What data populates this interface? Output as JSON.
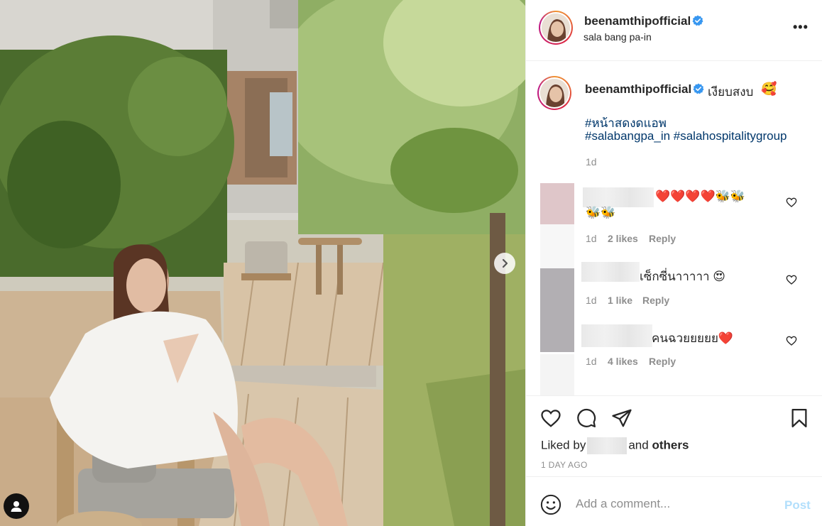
{
  "post": {
    "username": "beenamthipofficial",
    "location": "sala bang pa-in",
    "more_label": "•••"
  },
  "caption": {
    "username": "beenamthipofficial",
    "text": "เงียบสงบ",
    "emoji": "🥰",
    "hashtags": [
      "#หน้าสดงดแอพ",
      "#salabangpa_in #salahospitalitygroup"
    ],
    "time": "1d"
  },
  "comments": [
    {
      "text": "❤️❤️❤️❤️🐝🐝",
      "text2": "🐝🐝",
      "time": "1d",
      "likes": "2 likes",
      "reply": "Reply"
    },
    {
      "text": "เซ็กซี่นาาาาา 😍",
      "time": "1d",
      "likes": "1 like",
      "reply": "Reply"
    },
    {
      "text": "คนฉวยยยยย❤️",
      "time": "1d",
      "likes": "4 likes",
      "reply": "Reply"
    }
  ],
  "likes_summary": {
    "prefix": "Liked by",
    "suffix_plain": "and",
    "suffix_bold": "others"
  },
  "posted_ago": "1 DAY AGO",
  "comment_box": {
    "placeholder": "Add a comment...",
    "post_label": "Post"
  },
  "colors": {
    "accent_blue": "#0095f6",
    "post_disabled": "#b2dffc",
    "hashtag": "#00376b",
    "muted": "#8e8e8e"
  },
  "icons": [
    "verified-badge-icon",
    "more-options-icon",
    "chevron-right-icon",
    "user-tag-icon",
    "heart-icon",
    "comment-icon",
    "share-icon",
    "bookmark-icon",
    "emoji-smile-icon"
  ]
}
